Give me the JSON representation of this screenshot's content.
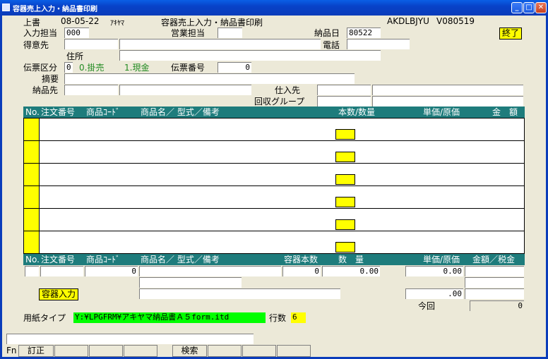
{
  "window": {
    "title": "容器売上入力・納品書印刷"
  },
  "header": {
    "mode": "上書",
    "date": "08-05-22",
    "user": "ｱｷﾔﾏ",
    "screen_title": "容器売上入力・納品書印刷",
    "program_id": "AKDLBJYU",
    "version": "V080519",
    "exit_label": "終了"
  },
  "form": {
    "input_staff_label": "入力担当",
    "input_staff_value": "000",
    "sales_staff_label": "営業担当",
    "delivery_date_label": "納品日",
    "delivery_date_value": "80522",
    "customer_label": "得意先",
    "phone_label": "電話",
    "address_label": "住所",
    "slip_type_label": "伝票区分",
    "slip_type_value": "0",
    "slip_option_credit": "0.掛売",
    "slip_option_cash": "1.現金",
    "slip_no_label": "伝票番号",
    "slip_no_value": "0",
    "summary_label": "摘要",
    "delivery_to_label": "納品先",
    "supplier_label": "仕入先",
    "collect_group_label": "回収グループ"
  },
  "grid": {
    "columns": [
      "No.",
      "注文番号",
      "商品ｺｰﾄﾞ",
      "商品名／ 型式／備考",
      "本数/数量",
      "単価/原価",
      "金　額"
    ]
  },
  "entry": {
    "columns": [
      "No.",
      "注文番号",
      "商品ｺｰﾄﾞ",
      "商品名／ 型式／備考",
      "容器本数",
      "数　量",
      "単価/原価",
      "金額／税金"
    ],
    "product_code": "0",
    "container_count": "0",
    "quantity": "0.00",
    "unit_price": "0.00",
    "sub_price": ".00",
    "container_button": "容器入力",
    "current_label": "今回",
    "current_value": "0"
  },
  "paper": {
    "label": "用紙タイプ",
    "value": "Y:¥LPGFRM¥アキヤマ納品書Ａ５form.itd",
    "lines_label": "行数",
    "lines_value": "6"
  },
  "fnbar": {
    "label": "Fn",
    "f1": "訂正",
    "f4": "検索"
  }
}
